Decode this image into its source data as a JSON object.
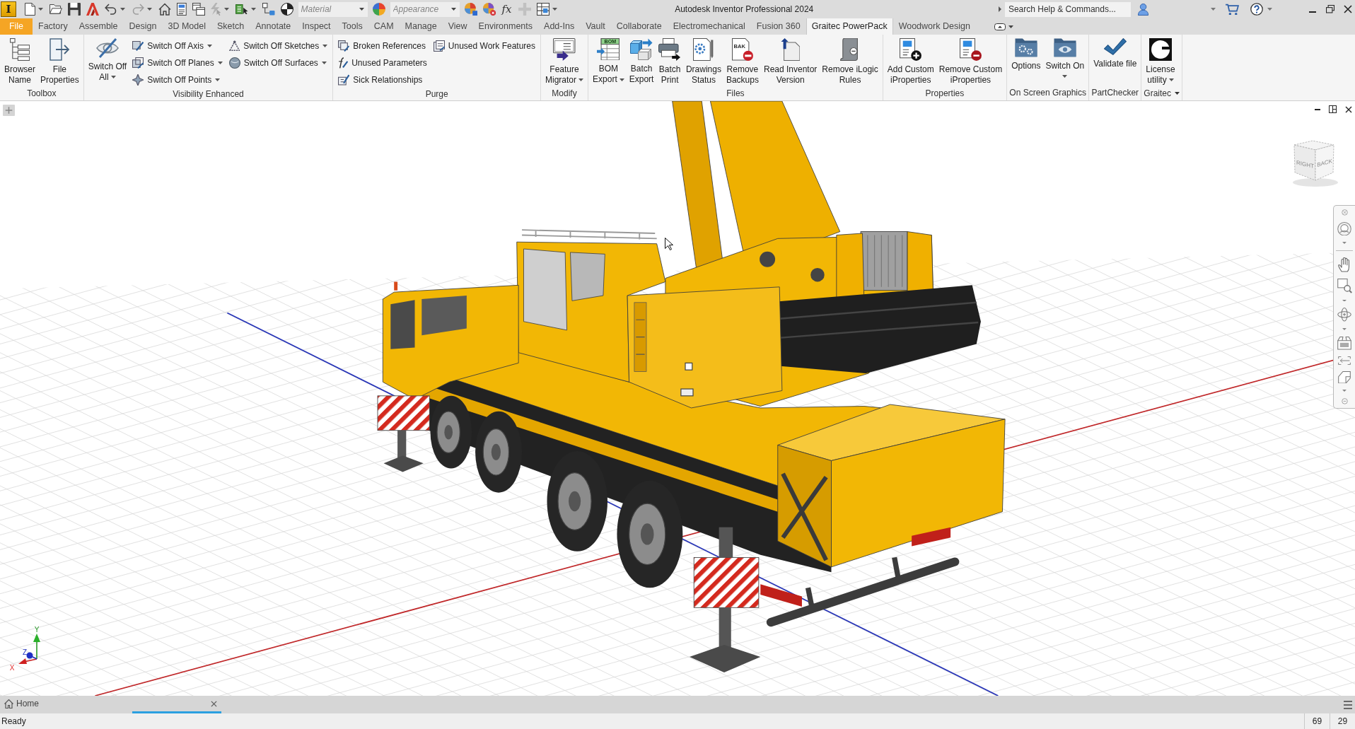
{
  "window": {
    "title": "Autodesk Inventor Professional 2024"
  },
  "app_logo": {
    "letter": "I"
  },
  "quick_access": [
    {
      "kind": "button",
      "disabled": false,
      "dropdown": true
    },
    {
      "kind": "button",
      "disabled": false,
      "dropdown": false
    },
    {
      "kind": "button",
      "disabled": false,
      "dropdown": false
    },
    {
      "kind": "button",
      "disabled": false,
      "dropdown": false
    },
    {
      "kind": "button",
      "disabled": false,
      "dropdown": true
    },
    {
      "kind": "button",
      "disabled": true,
      "dropdown": true
    },
    {
      "kind": "button",
      "disabled": false,
      "dropdown": false
    },
    {
      "kind": "button",
      "disabled": false,
      "dropdown": false
    },
    {
      "kind": "button",
      "disabled": false,
      "dropdown": false
    },
    {
      "kind": "button",
      "disabled": true,
      "dropdown": true
    },
    {
      "kind": "button",
      "disabled": false,
      "dropdown": true
    },
    {
      "kind": "button",
      "disabled": false,
      "dropdown": false
    },
    {
      "kind": "button",
      "disabled": false,
      "dropdown": false
    },
    {
      "kind": "combo",
      "placeholder": "Material",
      "disabled": false,
      "dropdown": true
    },
    {
      "kind": "button",
      "disabled": false,
      "dropdown": false
    },
    {
      "kind": "combo",
      "placeholder": "Appearance",
      "disabled": false,
      "dropdown": true
    },
    {
      "kind": "button",
      "disabled": false,
      "dropdown": false
    },
    {
      "kind": "button",
      "disabled": false,
      "dropdown": false
    },
    {
      "kind": "glyph",
      "glyph": "fx",
      "disabled": false,
      "dropdown": false
    },
    {
      "kind": "button",
      "disabled": true,
      "dropdown": false
    },
    {
      "kind": "button",
      "disabled": false,
      "dropdown": true
    }
  ],
  "search": {
    "placeholder": "Search Help & Commands..."
  },
  "file_button": {
    "label": "File"
  },
  "tabs": [
    {
      "label": "Factory",
      "selected": false
    },
    {
      "label": "Assemble",
      "selected": false
    },
    {
      "label": "Design",
      "selected": false
    },
    {
      "label": "3D Model",
      "selected": false
    },
    {
      "label": "Sketch",
      "selected": false
    },
    {
      "label": "Annotate",
      "selected": false
    },
    {
      "label": "Inspect",
      "selected": false
    },
    {
      "label": "Tools",
      "selected": false
    },
    {
      "label": "CAM",
      "selected": false
    },
    {
      "label": "Manage",
      "selected": false
    },
    {
      "label": "View",
      "selected": false
    },
    {
      "label": "Environments",
      "selected": false
    },
    {
      "label": "Add-Ins",
      "selected": false
    },
    {
      "label": "Vault",
      "selected": false
    },
    {
      "label": "Collaborate",
      "selected": false
    },
    {
      "label": "Electromechanical",
      "selected": false
    },
    {
      "label": "Fusion 360",
      "selected": false
    },
    {
      "label": "Graitec PowerPack",
      "selected": true
    },
    {
      "label": "Woodwork Design",
      "selected": false
    }
  ],
  "ribbon": {
    "panels": [
      {
        "title": "Toolbox",
        "dropdown": false,
        "items": [
          {
            "kind": "large",
            "label": "Browser\nName",
            "dropdown": false
          },
          {
            "kind": "large",
            "label": "File\nProperties",
            "dropdown": false
          }
        ]
      },
      {
        "title": "Visibility Enhanced",
        "dropdown": false,
        "items": [
          {
            "kind": "large",
            "label": "Switch Off\nAll",
            "dropdown": true
          },
          {
            "kind": "stack",
            "buttons": [
              {
                "label": "Switch Off Axis",
                "dropdown": true
              },
              {
                "label": "Switch Off Planes",
                "dropdown": true
              },
              {
                "label": "Switch Off Points",
                "dropdown": true
              }
            ]
          },
          {
            "kind": "stack",
            "buttons": [
              {
                "label": "Switch Off Sketches",
                "dropdown": true
              },
              {
                "label": "Switch Off Surfaces",
                "dropdown": true
              }
            ]
          }
        ]
      },
      {
        "title": "Purge",
        "dropdown": false,
        "items": [
          {
            "kind": "stack",
            "buttons": [
              {
                "label": "Broken References",
                "dropdown": false
              },
              {
                "label": "Unused Parameters",
                "dropdown": false
              },
              {
                "label": "Sick Relationships",
                "dropdown": false
              }
            ]
          },
          {
            "kind": "stack",
            "buttons": [
              {
                "label": "Unused Work Features",
                "dropdown": false
              }
            ]
          }
        ]
      },
      {
        "title": "Modify",
        "dropdown": false,
        "items": [
          {
            "kind": "large",
            "label": "Feature\nMigrator",
            "dropdown": true
          }
        ]
      },
      {
        "title": "Files",
        "dropdown": false,
        "items": [
          {
            "kind": "large",
            "label": "BOM\nExport",
            "dropdown": true,
            "icon_text": "BOM"
          },
          {
            "kind": "large",
            "label": "Batch\nExport",
            "dropdown": false
          },
          {
            "kind": "large",
            "label": "Batch\nPrint",
            "dropdown": false
          },
          {
            "kind": "large",
            "label": "Drawings\nStatus",
            "dropdown": false
          },
          {
            "kind": "large",
            "label": "Remove\nBackups",
            "dropdown": false,
            "icon_text": "BAK"
          },
          {
            "kind": "large",
            "label": "Read Inventor\nVersion",
            "dropdown": false
          },
          {
            "kind": "large",
            "label": "Remove iLogic\nRules",
            "dropdown": false
          }
        ]
      },
      {
        "title": "Properties",
        "dropdown": false,
        "items": [
          {
            "kind": "large",
            "label": "Add Custom\niProperties",
            "dropdown": false
          },
          {
            "kind": "large",
            "label": "Remove Custom\niProperties",
            "dropdown": false
          }
        ]
      },
      {
        "title": "On Screen Graphics",
        "dropdown": false,
        "items": [
          {
            "kind": "large",
            "label": "Options",
            "dropdown": false
          },
          {
            "kind": "large",
            "label": "Switch On",
            "dropdown": true
          }
        ]
      },
      {
        "title": "PartChecker",
        "dropdown": false,
        "items": [
          {
            "kind": "large",
            "label": "Validate file",
            "dropdown": false
          }
        ]
      },
      {
        "title": "Graitec",
        "dropdown": true,
        "items": [
          {
            "kind": "large",
            "label": "License\nutility",
            "dropdown": true
          }
        ]
      }
    ]
  },
  "viewport": {
    "view_cube": {
      "faces": [
        "RIGHT",
        "BACK"
      ]
    },
    "triad": {
      "x": "X",
      "y": "Y",
      "z": "Z"
    }
  },
  "document_tabs": [
    {
      "kind": "home",
      "label": "Home",
      "selected": false,
      "closable": false
    },
    {
      "kind": "document",
      "selected": true,
      "closable": true
    }
  ],
  "status_bar": {
    "message": "Ready",
    "cells": [
      "69",
      "29"
    ]
  }
}
